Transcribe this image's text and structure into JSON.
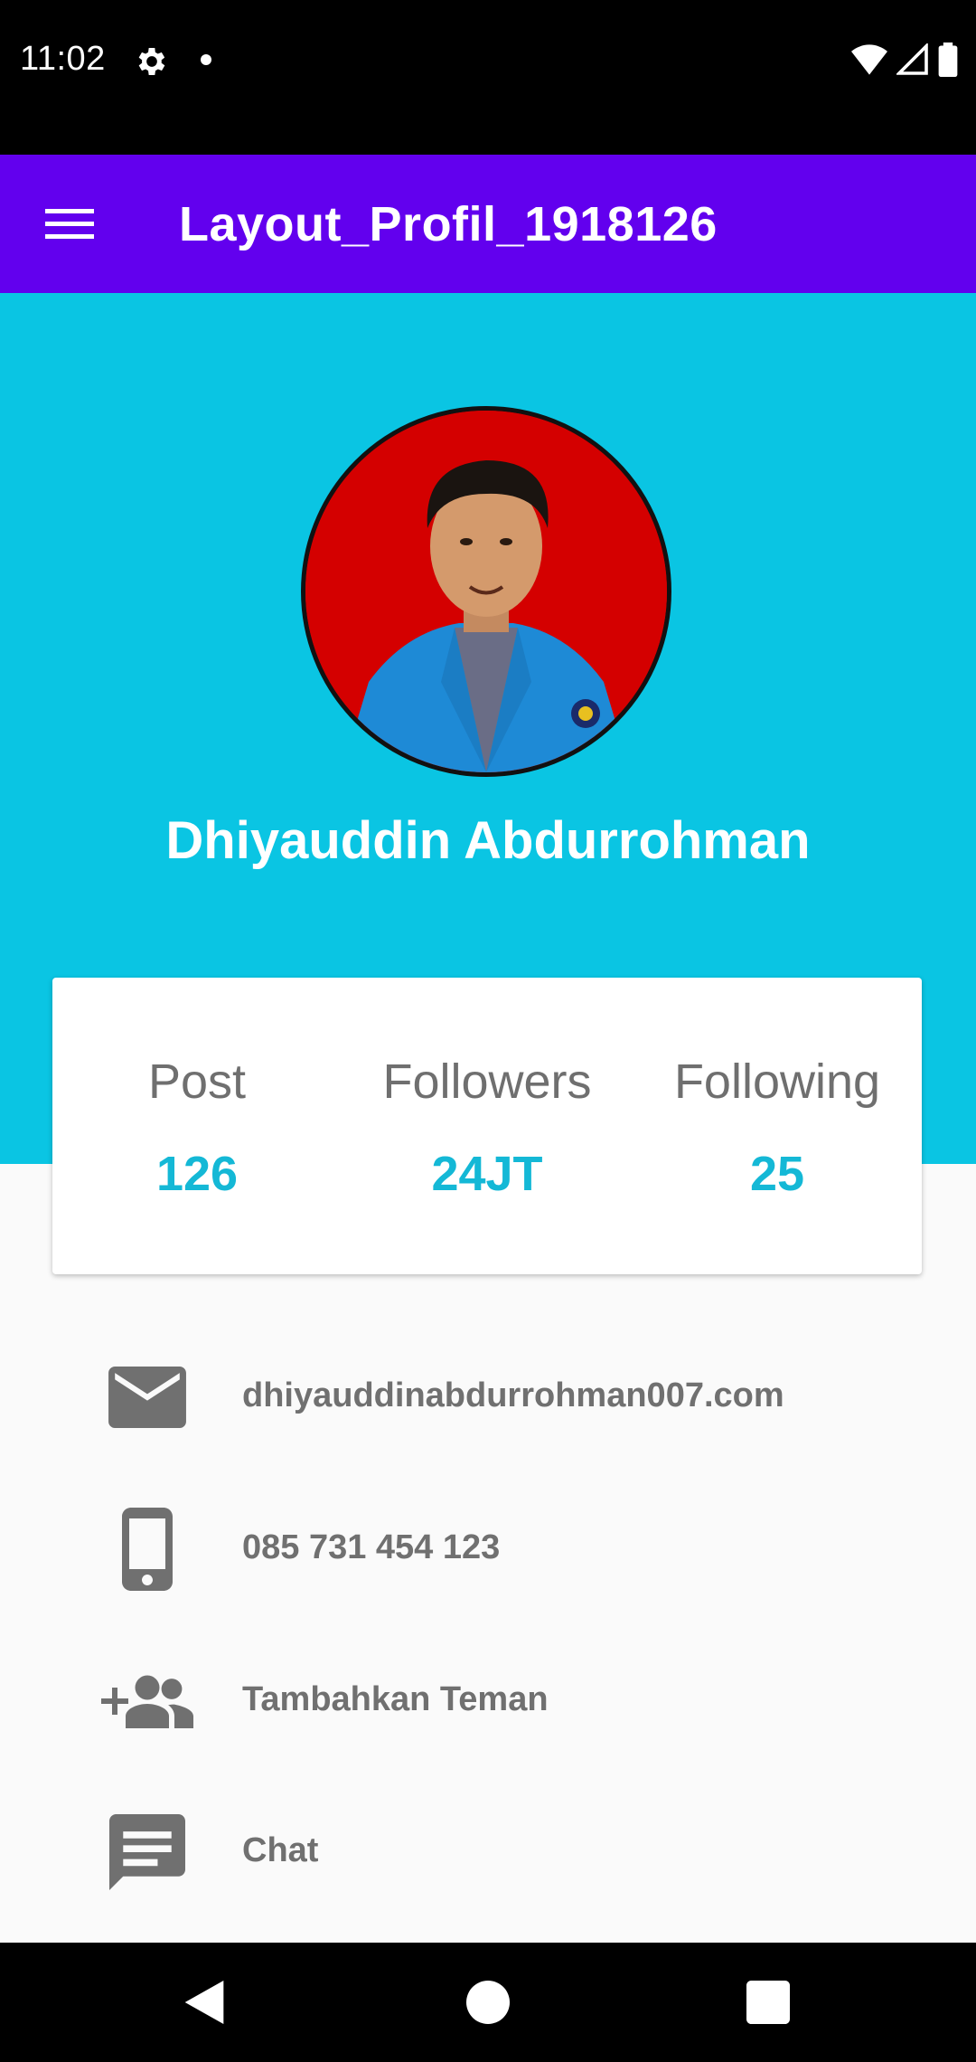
{
  "status_bar": {
    "time": "11:02",
    "icons": [
      "gear-icon",
      "notification-dot-icon",
      "wifi-icon",
      "cell-signal-icon",
      "battery-icon"
    ]
  },
  "app_bar": {
    "title": "Layout_Profil_1918126",
    "background": "#6200ee",
    "menu_icon": "hamburger-menu-icon"
  },
  "profile": {
    "name": "Dhiyauddin Abdurrohman",
    "header_color": "#0ac5e3",
    "avatar_background": "#d40000"
  },
  "stats": [
    {
      "label": "Post",
      "value": "126"
    },
    {
      "label": "Followers",
      "value": "24JT"
    },
    {
      "label": "Following",
      "value": "25"
    }
  ],
  "stat_value_color": "#14b8d6",
  "info_items": [
    {
      "icon": "email-icon",
      "text": "dhiyauddinabdurrohman007.com"
    },
    {
      "icon": "phone-icon",
      "text": "085 731 454 123"
    },
    {
      "icon": "add-friend-icon",
      "text": "Tambahkan Teman"
    },
    {
      "icon": "chat-icon",
      "text": "Chat"
    }
  ],
  "nav_bar": {
    "buttons": [
      "back-icon",
      "home-icon",
      "recents-icon"
    ]
  }
}
